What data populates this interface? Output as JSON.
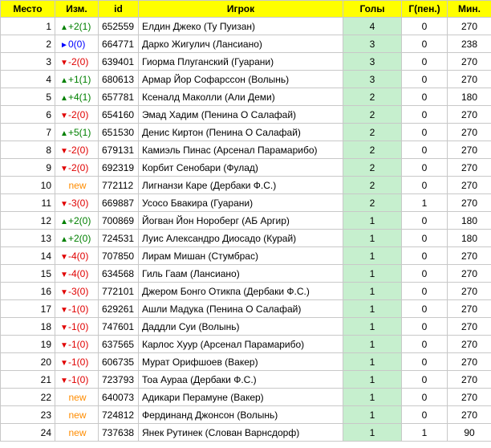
{
  "headers": {
    "place": "Место",
    "change": "Изм.",
    "id": "id",
    "player": "Игрок",
    "goals": "Голы",
    "pen": "Г(пен.)",
    "min": "Мин."
  },
  "colors": {
    "header_bg": "#ffff00",
    "goals_bg": "#c6efce",
    "up": "#008000",
    "down": "#e00000",
    "same": "#0000ff",
    "new": "#ff8c00"
  },
  "rows": [
    {
      "place": "1",
      "dir": "up",
      "change": "+2(1)",
      "id": "652559",
      "player": "Елдин Джеко (Ту Пуизан)",
      "goals": "4",
      "pen": "0",
      "min": "270"
    },
    {
      "place": "2",
      "dir": "same",
      "change": "0(0)",
      "id": "664771",
      "player": "Дарко Жигулич (Лансиано)",
      "goals": "3",
      "pen": "0",
      "min": "238"
    },
    {
      "place": "3",
      "dir": "down",
      "change": "-2(0)",
      "id": "639401",
      "player": "Гиорма Плуганский (Гуарани)",
      "goals": "3",
      "pen": "0",
      "min": "270"
    },
    {
      "place": "4",
      "dir": "up",
      "change": "+1(1)",
      "id": "680613",
      "player": "Армар Йор Софарссон (Волынь)",
      "goals": "3",
      "pen": "0",
      "min": "270"
    },
    {
      "place": "5",
      "dir": "up",
      "change": "+4(1)",
      "id": "657781",
      "player": "Ксеналд Маколли (Али Деми)",
      "goals": "2",
      "pen": "0",
      "min": "180"
    },
    {
      "place": "6",
      "dir": "down",
      "change": "-2(0)",
      "id": "654160",
      "player": "Эмад Хадим (Пенина О Салафай)",
      "goals": "2",
      "pen": "0",
      "min": "270"
    },
    {
      "place": "7",
      "dir": "up",
      "change": "+5(1)",
      "id": "651530",
      "player": "Денис Киртон (Пенина О Салафай)",
      "goals": "2",
      "pen": "0",
      "min": "270"
    },
    {
      "place": "8",
      "dir": "down",
      "change": "-2(0)",
      "id": "679131",
      "player": "Камиэль Пинас (Арсенал Парамарибо)",
      "goals": "2",
      "pen": "0",
      "min": "270"
    },
    {
      "place": "9",
      "dir": "down",
      "change": "-2(0)",
      "id": "692319",
      "player": "Корбит Сенобари (Фулад)",
      "goals": "2",
      "pen": "0",
      "min": "270"
    },
    {
      "place": "10",
      "dir": "new",
      "change": "new",
      "id": "772112",
      "player": "Лигнанзи Каре (Дербаки Ф.С.)",
      "goals": "2",
      "pen": "0",
      "min": "270"
    },
    {
      "place": "11",
      "dir": "down",
      "change": "-3(0)",
      "id": "669887",
      "player": "Усосо Бвакира (Гуарани)",
      "goals": "2",
      "pen": "1",
      "min": "270"
    },
    {
      "place": "12",
      "dir": "up",
      "change": "+2(0)",
      "id": "700869",
      "player": "Йогван Йон Нороберг (АБ Аргир)",
      "goals": "1",
      "pen": "0",
      "min": "180"
    },
    {
      "place": "13",
      "dir": "up",
      "change": "+2(0)",
      "id": "724531",
      "player": "Луис Александро Диосадо (Курай)",
      "goals": "1",
      "pen": "0",
      "min": "180"
    },
    {
      "place": "14",
      "dir": "down",
      "change": "-4(0)",
      "id": "707850",
      "player": "Лирам Мишан (Стумбрас)",
      "goals": "1",
      "pen": "0",
      "min": "270"
    },
    {
      "place": "15",
      "dir": "down",
      "change": "-4(0)",
      "id": "634568",
      "player": "Гиль Гаам (Лансиано)",
      "goals": "1",
      "pen": "0",
      "min": "270"
    },
    {
      "place": "16",
      "dir": "down",
      "change": "-3(0)",
      "id": "772101",
      "player": "Джером Бонго Отикпа (Дербаки Ф.С.)",
      "goals": "1",
      "pen": "0",
      "min": "270"
    },
    {
      "place": "17",
      "dir": "down",
      "change": "-1(0)",
      "id": "629261",
      "player": "Ашли Мадука (Пенина О Салафай)",
      "goals": "1",
      "pen": "0",
      "min": "270"
    },
    {
      "place": "18",
      "dir": "down",
      "change": "-1(0)",
      "id": "747601",
      "player": "Даддли Суи (Волынь)",
      "goals": "1",
      "pen": "0",
      "min": "270"
    },
    {
      "place": "19",
      "dir": "down",
      "change": "-1(0)",
      "id": "637565",
      "player": "Карлос Хуур (Арсенал Парамарибо)",
      "goals": "1",
      "pen": "0",
      "min": "270"
    },
    {
      "place": "20",
      "dir": "down",
      "change": "-1(0)",
      "id": "606735",
      "player": "Мурат Орифшоев (Вакер)",
      "goals": "1",
      "pen": "0",
      "min": "270"
    },
    {
      "place": "21",
      "dir": "down",
      "change": "-1(0)",
      "id": "723793",
      "player": "Тоа Аураа (Дербаки Ф.С.)",
      "goals": "1",
      "pen": "0",
      "min": "270"
    },
    {
      "place": "22",
      "dir": "new",
      "change": "new",
      "id": "640073",
      "player": "Адикари Перамуне (Вакер)",
      "goals": "1",
      "pen": "0",
      "min": "270"
    },
    {
      "place": "23",
      "dir": "new",
      "change": "new",
      "id": "724812",
      "player": "Фердинанд Джонсон (Волынь)",
      "goals": "1",
      "pen": "0",
      "min": "270"
    },
    {
      "place": "24",
      "dir": "new",
      "change": "new",
      "id": "737638",
      "player": "Янек Рутинек (Слован Варнсдорф)",
      "goals": "1",
      "pen": "1",
      "min": "90"
    }
  ]
}
